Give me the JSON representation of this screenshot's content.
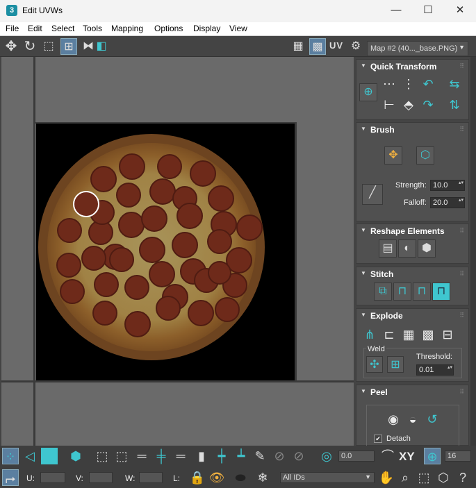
{
  "window": {
    "title": "Edit UVWs",
    "app_icon_text": "3",
    "minimize": "—",
    "maximize": "☐",
    "close": "✕"
  },
  "menu": [
    "File",
    "Edit",
    "Select",
    "Tools",
    "Mapping",
    "Options",
    "Display",
    "View"
  ],
  "toolbar": {
    "uv_label": "UV",
    "map_select": "Map #2 (40..._base.PNG)"
  },
  "quick_transform": {
    "title": "Quick Transform"
  },
  "brush": {
    "title": "Brush",
    "strength_label": "Strength:",
    "strength_value": "10.0",
    "falloff_label": "Falloff:",
    "falloff_value": "20.0"
  },
  "reshape": {
    "title": "Reshape Elements"
  },
  "stitch": {
    "title": "Stitch"
  },
  "explode": {
    "title": "Explode",
    "weld_label": "Weld",
    "threshold_label": "Threshold:",
    "threshold_value": "0.01"
  },
  "peel": {
    "title": "Peel",
    "detach_label": "Detach",
    "detach_checked": true
  },
  "bottom": {
    "angle_value": "0.0",
    "xy_label": "XY",
    "grid_value": "16",
    "u_label": "U:",
    "v_label": "V:",
    "w_label": "W:",
    "l_label": "L:",
    "ids_select": "All IDs"
  },
  "colors": {
    "accent": "#3fc6cf",
    "panel_bg": "#505050",
    "viewport_bg": "#6a6a6a"
  }
}
